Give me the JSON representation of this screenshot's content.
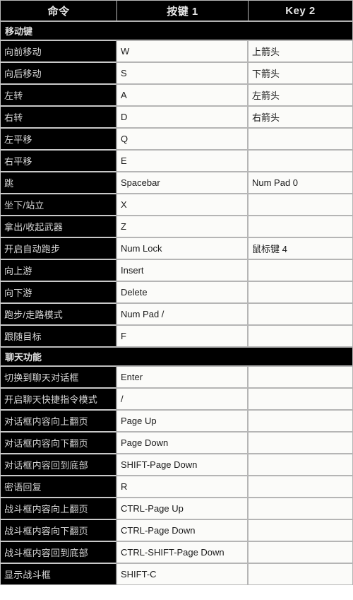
{
  "table": {
    "columns": [
      "命令",
      "按键 1",
      "Key 2"
    ],
    "sections": [
      {
        "title": "移动键",
        "rows": [
          {
            "command": "向前移动",
            "key1": "W",
            "key2": "上箭头"
          },
          {
            "command": "向后移动",
            "key1": "S",
            "key2": "下箭头"
          },
          {
            "command": "左转",
            "key1": "A",
            "key2": "左箭头"
          },
          {
            "command": "右转",
            "key1": "D",
            "key2": "右箭头"
          },
          {
            "command": "左平移",
            "key1": "Q",
            "key2": ""
          },
          {
            "command": "右平移",
            "key1": "E",
            "key2": ""
          },
          {
            "command": "跳",
            "key1": "Spacebar",
            "key2": "Num Pad 0"
          },
          {
            "command": "坐下/站立",
            "key1": "X",
            "key2": ""
          },
          {
            "command": "拿出/收起武器",
            "key1": "Z",
            "key2": ""
          },
          {
            "command": "开启自动跑步",
            "key1": "Num Lock",
            "key2": "鼠标键 4"
          },
          {
            "command": "向上游",
            "key1": "Insert",
            "key2": ""
          },
          {
            "command": "向下游",
            "key1": "Delete",
            "key2": ""
          },
          {
            "command": "跑步/走路模式",
            "key1": "Num Pad /",
            "key2": ""
          },
          {
            "command": "跟随目标",
            "key1": "F",
            "key2": ""
          }
        ]
      },
      {
        "title": "聊天功能",
        "rows": [
          {
            "command": "切换到聊天对话框",
            "key1": "Enter",
            "key2": ""
          },
          {
            "command": "开启聊天快捷指令模式",
            "key1": "/",
            "key2": ""
          },
          {
            "command": "对话框内容向上翻页",
            "key1": "Page Up",
            "key2": ""
          },
          {
            "command": "对话框内容向下翻页",
            "key1": "Page Down",
            "key2": ""
          },
          {
            "command": "对话框内容回到底部",
            "key1": "SHIFT-Page Down",
            "key2": ""
          },
          {
            "command": "密语回复",
            "key1": "R",
            "key2": ""
          },
          {
            "command": "战斗框内容向上翻页",
            "key1": "CTRL-Page Up",
            "key2": ""
          },
          {
            "command": "战斗框内容向下翻页",
            "key1": "CTRL-Page Down",
            "key2": ""
          },
          {
            "command": "战斗框内容回到底部",
            "key1": "CTRL-SHIFT-Page Down",
            "key2": ""
          },
          {
            "command": "显示战斗框",
            "key1": "SHIFT-C",
            "key2": ""
          }
        ]
      }
    ]
  },
  "colors": {
    "header_bg": "#000000",
    "header_fg": "#e8e8e8",
    "command_bg": "#000000",
    "command_fg": "#d8d8d8",
    "key_bg": "#fbfbf9",
    "key_fg": "#1a1a1a",
    "border": "#b5b5b5"
  }
}
